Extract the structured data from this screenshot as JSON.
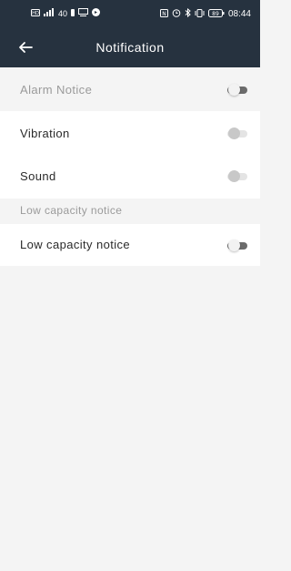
{
  "status_bar": {
    "left_icons": [
      "hd-icon",
      "signal-icon",
      "network-speed-icon",
      "notification-dot-icon",
      "screen-icon",
      "app-icon"
    ],
    "network_speed": "40",
    "right_icons": [
      "nfc-icon",
      "alarm-icon",
      "bluetooth-icon",
      "vibrate-icon",
      "battery-icon"
    ],
    "battery": "89",
    "time": "08:44"
  },
  "header": {
    "title": "Notification",
    "back_icon": "arrow-left-icon"
  },
  "settings": {
    "alarm_notice_label": "Alarm Notice",
    "vibration_label": "Vibration",
    "sound_label": "Sound",
    "section_low_capacity": "Low capacity notice",
    "low_capacity_label": "Low capacity notice"
  },
  "toggles": {
    "alarm_notice": "off",
    "vibration": "off",
    "sound": "off",
    "low_capacity": "off"
  },
  "colors": {
    "header_bg": "#26323f",
    "page_bg": "#f4f4f4",
    "row_bg": "#ffffff"
  }
}
